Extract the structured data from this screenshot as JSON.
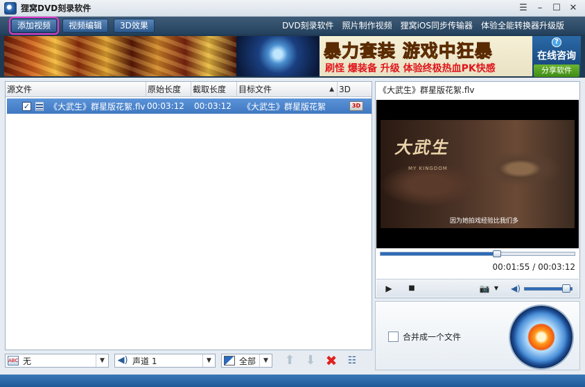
{
  "window": {
    "title": "狸窝DVD刻录软件",
    "controls": [
      "menu",
      "minimize",
      "maximize",
      "close"
    ]
  },
  "toolbar": {
    "buttons": [
      "添加视频",
      "视频编辑",
      "3D效果"
    ],
    "links": [
      "DVD刻录软件",
      "照片制作视频",
      "狸窝iOS同步传输器",
      "体验全能转换器升级版"
    ]
  },
  "banner": {
    "ad_main": "暴力套装 游戏中狂暴",
    "ad_sub": "刷怪 爆装备 升级 体验终极热血PK快感",
    "help": "?",
    "consult": "在线咨询",
    "share": "分享软件"
  },
  "filelist": {
    "columns": [
      "源文件",
      "原始长度",
      "截取长度",
      "目标文件",
      "3D"
    ],
    "sort_indicator": "▲",
    "rows": [
      {
        "checked": "✓",
        "source": "《大武生》群星版花絮.flv",
        "original_length": "00:03:12",
        "clip_length": "00:03:12",
        "target": "《大武生》群星版花絮",
        "badge_3d": "3D"
      }
    ]
  },
  "bottom_controls": {
    "subtitle_label": "无",
    "subtitle_icon": "ABC",
    "audio_label": "声道 1",
    "all_label": "全部"
  },
  "preview": {
    "title": "《大武生》群星版花絮.flv",
    "logo_text": "大武生",
    "logo_sub": "MY KINGDOM",
    "caption": "因为她拍戏经验比我们多",
    "time": "00:01:55 / 00:03:12",
    "progress": 0.6,
    "volume": 0.9
  },
  "burn": {
    "merge_label": "合并成一个文件"
  },
  "colors": {
    "toolbar_bg": "#2e4c6a",
    "selection": "#4a84cc",
    "accent_highlight": "#e03ad0",
    "ad_yellow": "#f2c400",
    "ad_red": "#e0161c"
  }
}
